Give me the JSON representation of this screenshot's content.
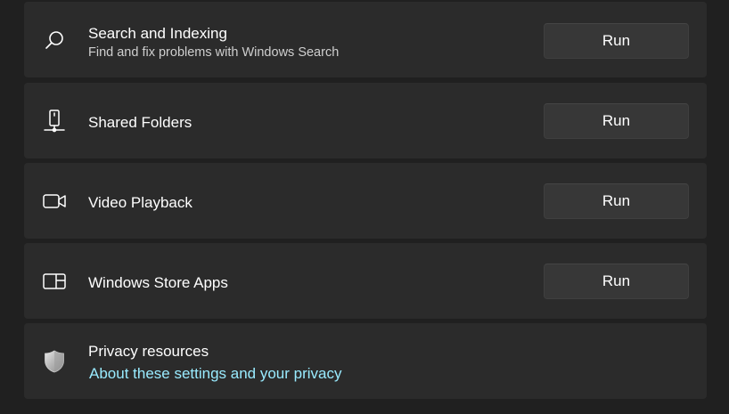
{
  "troubleshooters": [
    {
      "title": "Search and Indexing",
      "subtitle": "Find and fix problems with Windows Search",
      "icon": "search-icon",
      "button_label": "Run"
    },
    {
      "title": "Shared Folders",
      "icon": "shared-folders-icon",
      "button_label": "Run"
    },
    {
      "title": "Video Playback",
      "icon": "video-camera-icon",
      "button_label": "Run"
    },
    {
      "title": "Windows Store Apps",
      "icon": "store-apps-icon",
      "button_label": "Run"
    }
  ],
  "privacy": {
    "title": "Privacy resources",
    "link_text": "About these settings and your privacy",
    "icon": "shield-icon"
  },
  "colors": {
    "background": "#202020",
    "card": "#2b2b2b",
    "button": "#373737",
    "link": "#99ebff"
  }
}
